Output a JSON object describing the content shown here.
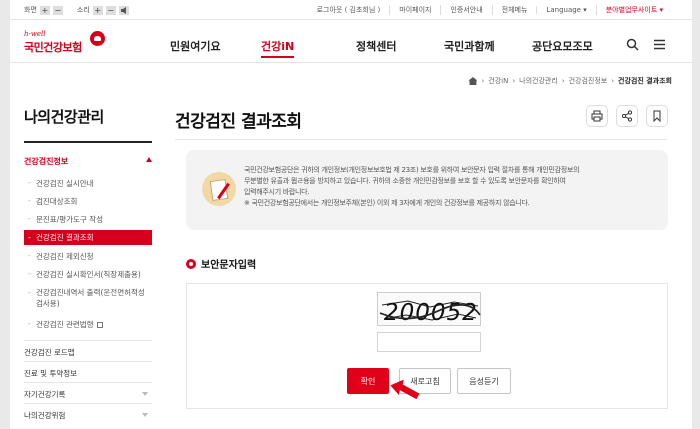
{
  "util": {
    "zoom_label": "화면",
    "sound_label": "소리",
    "plus": "+",
    "minus": "−",
    "links": [
      "로그아웃 ( 김초희님 )",
      "마이페이지",
      "인증서안내",
      "전체메뉴",
      "Language ▾"
    ],
    "site_link": "분야별업무사이트 ▾"
  },
  "logo": {
    "hwell": "h-well",
    "name": "국민건강보험"
  },
  "gnb": {
    "items": [
      "민원여기요",
      "건강iN",
      "정책센터",
      "국민과함께",
      "공단요모조모"
    ]
  },
  "breadcrumb": {
    "items": [
      "건강iN",
      "나의건강관리",
      "건강검진정보"
    ],
    "current": "건강검진 결과조회"
  },
  "lnb": {
    "title": "나의건강관리",
    "section": "건강검진정보",
    "sub_items": [
      "건강검진 실시안내",
      "검진대상조회",
      "문진표/평가도구 작성",
      "건강검진 결과조회",
      "건강검진 제외신청",
      "건강검진 실시확인서(직장제출용)"
    ],
    "sub_long_1": "건강검진내역서 출력(운전면허적성",
    "sub_long_2": "검사용)",
    "sub_last": "건강검진 관련법령",
    "main_items": [
      "건강검진 로드맵",
      "진료 및 투약정보",
      "자기건강기록",
      "나의건강위험"
    ]
  },
  "page": {
    "title": "건강검진 결과조회"
  },
  "notice": {
    "lines": [
      "국민건강보험공단은 귀하의 개인정보(개인정보보호법 제 23조) 보호를 위하여 보안문자 입력 절차를 통해 개인민감정보의",
      "무분별한 유출과 뭡ㄹ용을 방지하고 있습니다. 귀하의 소중한 개인민감정보를 보호 할 수 있도록 보안문자를 확인하여",
      "입력해주시기 바랍니다.",
      "※ 국민건강보험공단에서는 개인정보주체(본인) 이외 제 3자에게 개인의 건강정보를 제공하지 않습니다."
    ]
  },
  "captcha_section": {
    "title": "보안문자입력",
    "code": "200052",
    "input_value": "",
    "confirm_label": "확인",
    "refresh_label": "새로고침",
    "audio_label": "음성듣기"
  },
  "colors": {
    "accent": "#d6001c",
    "button": "#e0001a"
  }
}
